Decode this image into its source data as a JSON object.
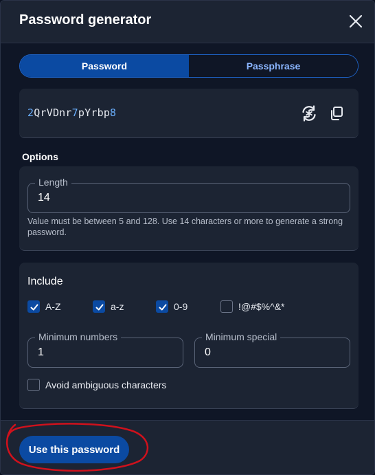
{
  "dialog": {
    "title": "Password generator",
    "close_icon": "close-icon"
  },
  "tabs": [
    {
      "label": "Password",
      "active": true
    },
    {
      "label": "Passphrase",
      "active": false
    }
  ],
  "generated": {
    "value": "2QrVDnr7pYrbp8",
    "digit_color": "#6ab0ff",
    "regenerate_icon": "refresh-icon",
    "copy_icon": "copy-icon"
  },
  "options": {
    "label": "Options",
    "length": {
      "label": "Length",
      "value": "14",
      "hint": "Value must be between 5 and 128. Use 14 characters or more to generate a strong password."
    }
  },
  "include": {
    "title": "Include",
    "checkboxes": [
      {
        "label": "A-Z",
        "checked": true
      },
      {
        "label": "a-z",
        "checked": true
      },
      {
        "label": "0-9",
        "checked": true
      },
      {
        "label": "!@#$%^&*",
        "checked": false
      }
    ],
    "min_numbers": {
      "label": "Minimum numbers",
      "value": "1"
    },
    "min_special": {
      "label": "Minimum special",
      "value": "0"
    },
    "avoid_ambiguous": {
      "label": "Avoid ambiguous characters",
      "checked": false
    }
  },
  "footer": {
    "use_label": "Use this password"
  },
  "colors": {
    "accent": "#0b4aa2",
    "link": "#8bb6ff",
    "annotation": "#d0111c"
  }
}
